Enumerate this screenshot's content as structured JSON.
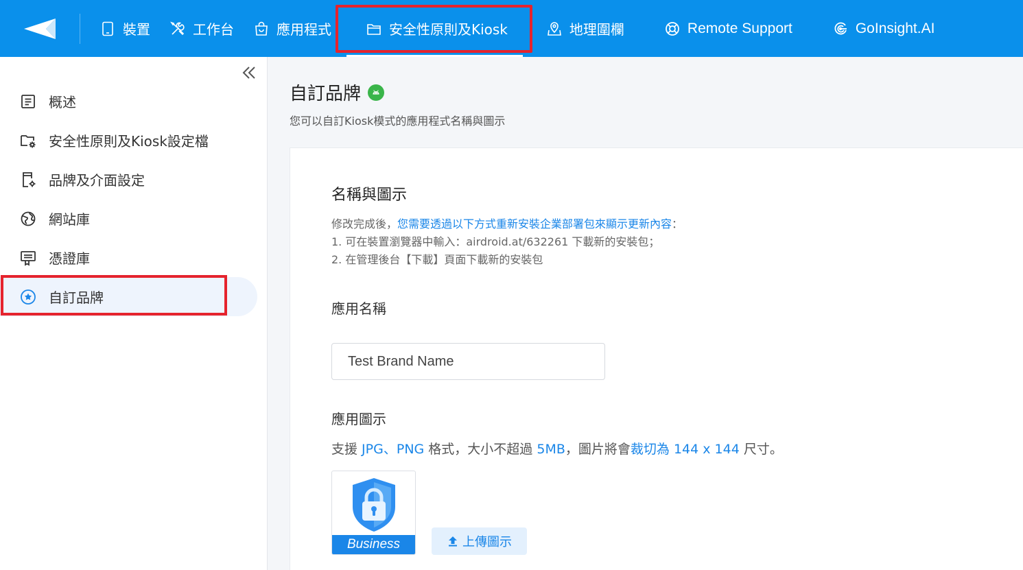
{
  "nav": {
    "items": [
      {
        "label": "裝置",
        "icon": "tablet-icon"
      },
      {
        "label": "工作台",
        "icon": "tools-icon"
      },
      {
        "label": "應用程式",
        "icon": "shopping-bag-icon"
      },
      {
        "label": "安全性原則及Kiosk",
        "icon": "folder-icon"
      },
      {
        "label": "地理圍欄",
        "icon": "map-pin-icon"
      },
      {
        "label": "Remote Support",
        "icon": "lifebuoy-icon"
      },
      {
        "label": "GoInsight.AI",
        "icon": "goinsight-icon"
      }
    ],
    "active_index": 3
  },
  "sidebar": {
    "items": [
      {
        "label": "概述",
        "icon": "list-doc-icon"
      },
      {
        "label": "安全性原則及Kiosk設定檔",
        "icon": "folder-gear-icon"
      },
      {
        "label": "品牌及介面設定",
        "icon": "phone-gear-icon"
      },
      {
        "label": "網站庫",
        "icon": "globe-icon"
      },
      {
        "label": "憑證庫",
        "icon": "certificate-icon"
      },
      {
        "label": "自訂品牌",
        "icon": "star-circle-icon"
      }
    ],
    "active_index": 5
  },
  "page": {
    "title": "自訂品牌",
    "description": "您可以自訂Kiosk模式的應用程式名稱與圖示"
  },
  "section": {
    "title": "名稱與圖示",
    "notice_prefix": "修改完成後，",
    "notice_link": "您需要透過以下方式重新安裝企業部署包來顯示更新內容",
    "notice_suffix": "：",
    "step1": "1. 可在裝置瀏覽器中輸入：airdroid.at/632261 下載新的安裝包；",
    "step2": "2. 在管理後台【下載】頁面下載新的安裝包"
  },
  "app_name": {
    "label": "應用名稱",
    "value": "Test Brand Name"
  },
  "app_icon": {
    "label": "應用圖示",
    "support_1": "支援 ",
    "fmt_jpg": "JPG",
    "sep": "、",
    "fmt_png": "PNG",
    "support_2": " 格式，大小不超過 ",
    "max_size": "5MB",
    "support_3": "，圖片將會",
    "crop": "裁切為 144 x 144",
    "support_4": " 尺寸。",
    "preview_caption": "Business",
    "upload_label": "上傳圖示"
  },
  "colors": {
    "topbar": "#0a90eb",
    "accent": "#1a86e8",
    "highlight_box": "#e5232d",
    "android": "#3ab54a"
  }
}
